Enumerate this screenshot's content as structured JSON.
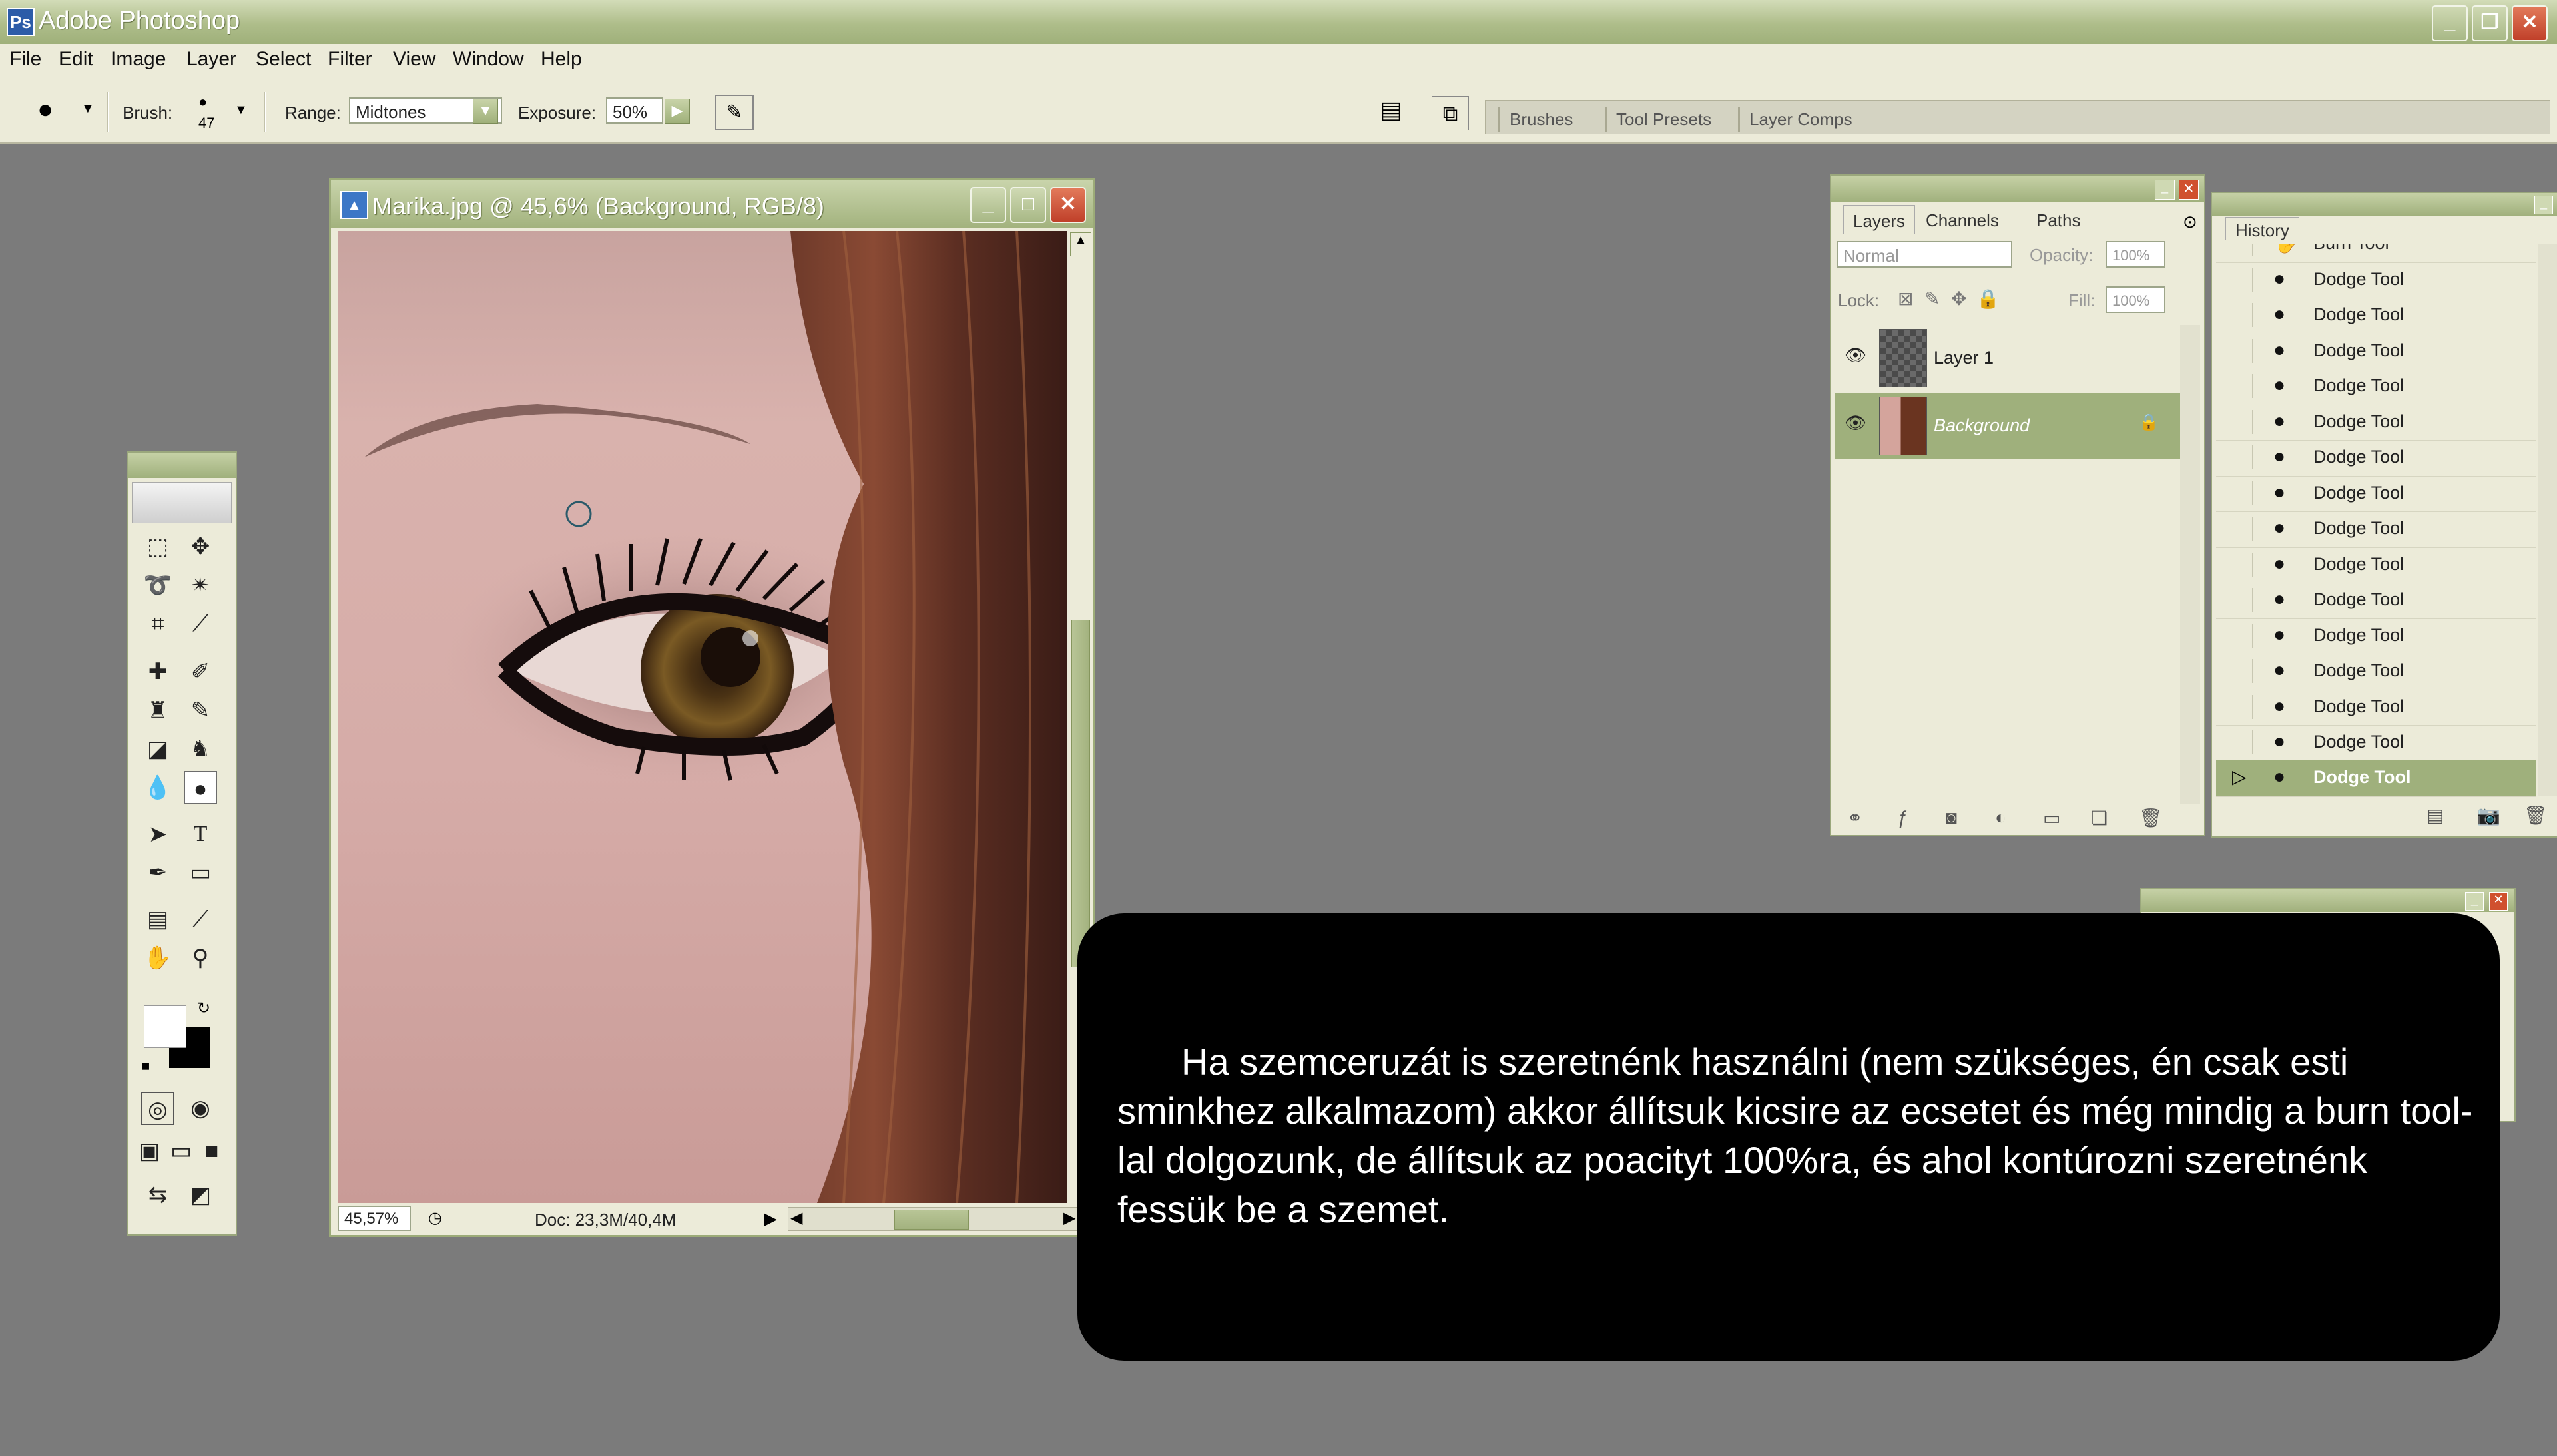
{
  "app": {
    "title": "Adobe Photoshop"
  },
  "menu": [
    "File",
    "Edit",
    "Image",
    "Layer",
    "Select",
    "Filter",
    "View",
    "Window",
    "Help"
  ],
  "options": {
    "brush_label": "Brush:",
    "brush_size": "47",
    "range_label": "Range:",
    "range_value": "Midtones",
    "exposure_label": "Exposure:",
    "exposure_value": "50%"
  },
  "palette_well": [
    "Brushes",
    "Tool Presets",
    "Layer Comps"
  ],
  "document": {
    "title": "Marika.jpg @ 45,6% (Background, RGB/8)",
    "zoom": "45,57%",
    "doc_size": "Doc: 23,3M/40,4M"
  },
  "layers_palette": {
    "tabs": [
      "Layers",
      "Channels",
      "Paths"
    ],
    "blend_mode": "Normal",
    "opacity_label": "Opacity:",
    "opacity_value": "100%",
    "lock_label": "Lock:",
    "fill_label": "Fill:",
    "fill_value": "100%",
    "layers": [
      {
        "name": "Layer 1",
        "selected": false
      },
      {
        "name": "Background",
        "selected": true
      }
    ]
  },
  "history_palette": {
    "title": "History",
    "items": [
      "Burn Tool",
      "Dodge Tool",
      "Dodge Tool",
      "Dodge Tool",
      "Dodge Tool",
      "Dodge Tool",
      "Dodge Tool",
      "Dodge Tool",
      "Dodge Tool",
      "Dodge Tool",
      "Dodge Tool",
      "Dodge Tool",
      "Dodge Tool",
      "Dodge Tool",
      "Dodge Tool",
      "Dodge Tool"
    ],
    "selected_index": 15
  },
  "caption": "Ha szemceruzát is szeretnénk használni (nem szükséges, én csak esti sminkhez alkalmazom) akkor állítsuk kicsire az ecsetet és még mindig a burn tool-lal dolgozunk, de állítsuk az poacityt 100%ra, és ahol kontúrozni szeretnénk fessük be a szemet.",
  "colors": {
    "accent": "#9fb07c",
    "chrome": "#ecebd9",
    "workspace": "#7b7b7b"
  }
}
